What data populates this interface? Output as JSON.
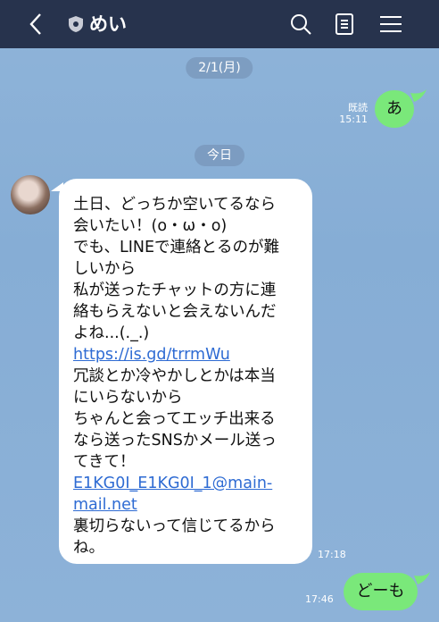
{
  "header": {
    "back_icon": "chevron-left-icon",
    "badge_icon": "shield-badge-icon",
    "contact_name": "めい",
    "search_icon": "search-icon",
    "notes_icon": "notes-icon",
    "menu_icon": "menu-icon",
    "background": "#27334d"
  },
  "chat": {
    "date_divider_1": "2/1(月)",
    "date_divider_2": "今日",
    "sent_1": {
      "text": "あ",
      "read_label": "既読",
      "time": "15:11"
    },
    "received_1": {
      "lines": [
        "土日、どっちか空いてるなら",
        "会いたい！(o・ω・o)",
        "でも、LINEで連絡とるのが難",
        "しいから",
        "私が送ったチャットの方に連",
        "絡もらえないと会えないんだ",
        "よね...(._.)",
        "https://is.gd/trrmWu",
        "冗談とか冷やかしとかは本当",
        "にいらないから",
        "ちゃんと会ってエッチ出来る",
        "なら送ったSNSかメール送っ",
        "てきて！",
        "E1KG0I_E1KG0I_1@main-",
        "mail.net",
        "裏切らないって信じてるから",
        "ね。"
      ],
      "time": "17:18"
    },
    "sent_2": {
      "text": "どーも",
      "time": "17:46"
    },
    "sent_bubble_color": "#7ae87a",
    "link_color": "#2e6bd3"
  }
}
